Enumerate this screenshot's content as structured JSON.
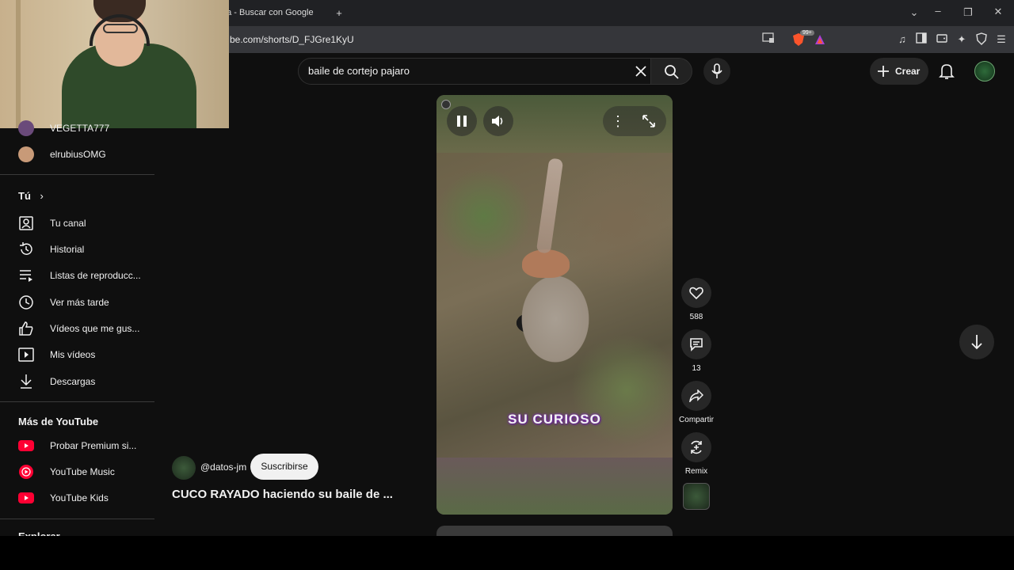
{
  "browser": {
    "tab_title": "da - Buscar con Google",
    "url": "be.com/shorts/D_FJGre1KyU",
    "badge_count": "99+"
  },
  "header": {
    "search_query": "baile de cortejo pajaro",
    "create_label": "Crear"
  },
  "sidebar": {
    "subscriptions_partial": [
      {
        "label": "VEGETTA777",
        "icon": "channel-avatar"
      },
      {
        "label": "elrubiusOMG",
        "icon": "channel-avatar"
      }
    ],
    "you_heading": "Tú",
    "you_items": [
      {
        "label": "Tu canal",
        "icon": "account-box-icon"
      },
      {
        "label": "Historial",
        "icon": "history-icon"
      },
      {
        "label": "Listas de reproducc...",
        "icon": "playlist-icon"
      },
      {
        "label": "Ver más tarde",
        "icon": "clock-icon"
      },
      {
        "label": "Vídeos que me gus...",
        "icon": "thumb-up-icon"
      },
      {
        "label": "Mis vídeos",
        "icon": "video-icon"
      },
      {
        "label": "Descargas",
        "icon": "download-icon"
      }
    ],
    "more_heading": "Más de YouTube",
    "more_items": [
      {
        "label": "Probar Premium si...",
        "icon": "youtube-premium-icon",
        "color": "#ff0033"
      },
      {
        "label": "YouTube Music",
        "icon": "youtube-music-icon",
        "color": "#ff0033"
      },
      {
        "label": "YouTube Kids",
        "icon": "youtube-kids-icon",
        "color": "#ff0033"
      }
    ],
    "cut_heading": "Explorar"
  },
  "short": {
    "channel_handle": "@datos-jm",
    "subscribe_label": "Suscribirse",
    "title": "CUCO RAYADO haciendo su baile de ...",
    "caption": "SU CURIOSO",
    "like_count": "588",
    "comment_count": "13",
    "share_label": "Compartir",
    "remix_label": "Remix"
  },
  "colors": {
    "page_bg": "#0f0f0f",
    "accent_red": "#ff0033"
  }
}
